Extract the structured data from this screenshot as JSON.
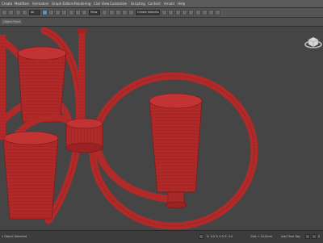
{
  "menu": [
    "Create",
    "Modifiers",
    "Animation",
    "Graph Editors",
    "Rendering",
    "Civil View",
    "Customize",
    "Scripting",
    "Content",
    "Arnold",
    "Help"
  ],
  "toolbar": {
    "selection_filter": "All",
    "view_dropdown": "View",
    "named_selection_placeholder": "Create Selection Se"
  },
  "ribbon": {
    "tabs": [
      "Object Paint"
    ]
  },
  "viewport": {
    "label": "",
    "viewcube_icon": "viewcube-icon",
    "object_color": "#b02a2a",
    "wire_color": "#7a1414",
    "background": "#454545"
  },
  "status": {
    "left_text": "1 Object Selected",
    "coords": "X: 0.0   Y: 0.0   Z: 0.0",
    "grid": "Grid = 10.0mm",
    "add_time_tag": "Add Time Tag",
    "frame": "0"
  }
}
